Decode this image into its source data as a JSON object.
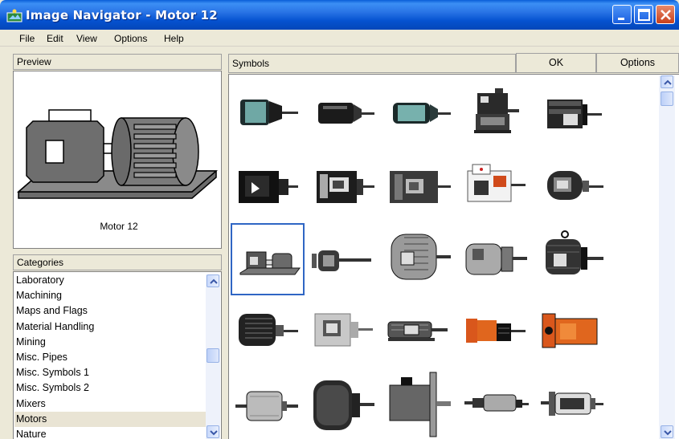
{
  "window": {
    "title": "Image Navigator - Motor 12"
  },
  "menu": [
    "File",
    "Edit",
    "View",
    "Options",
    "Help"
  ],
  "preview": {
    "header": "Preview",
    "caption": "Motor 12"
  },
  "categories": {
    "header": "Categories",
    "items": [
      "Laboratory",
      "Machining",
      "Maps and Flags",
      "Material Handling",
      "Mining",
      "Misc. Pipes",
      "Misc. Symbols 1",
      "Misc. Symbols 2",
      "Mixers",
      "Motors",
      "Nature"
    ],
    "selected": "Motors"
  },
  "symbols": {
    "header": "Symbols",
    "ok_label": "OK",
    "options_label": "Options",
    "selected_index": 10,
    "rows": [
      [
        "teal-motor-icon",
        "black-cylinder-motor-icon",
        "teal-cylinder-motor-icon",
        "geared-motor-icon",
        "flanged-motor-icon"
      ],
      [
        "black-box-motor-icon",
        "framed-motor-icon",
        "gray-frame-motor-icon",
        "white-control-motor-icon",
        "gray-round-motor-icon"
      ],
      [
        "base-motor-icon",
        "small-spindle-motor-icon",
        "large-gray-motor-icon",
        "silver-motor-icon",
        "lifting-eye-motor-icon"
      ],
      [
        "ribbed-motor-icon",
        "light-gray-motor-icon",
        "skid-motor-icon",
        "orange-gearbox-motor-icon",
        "orange-flange-motor-icon"
      ],
      [
        "silver-drum-motor-icon",
        "dark-drum-motor-icon",
        "servo-motor-icon",
        "linear-actuator-icon",
        "clear-housing-motor-icon"
      ]
    ]
  }
}
